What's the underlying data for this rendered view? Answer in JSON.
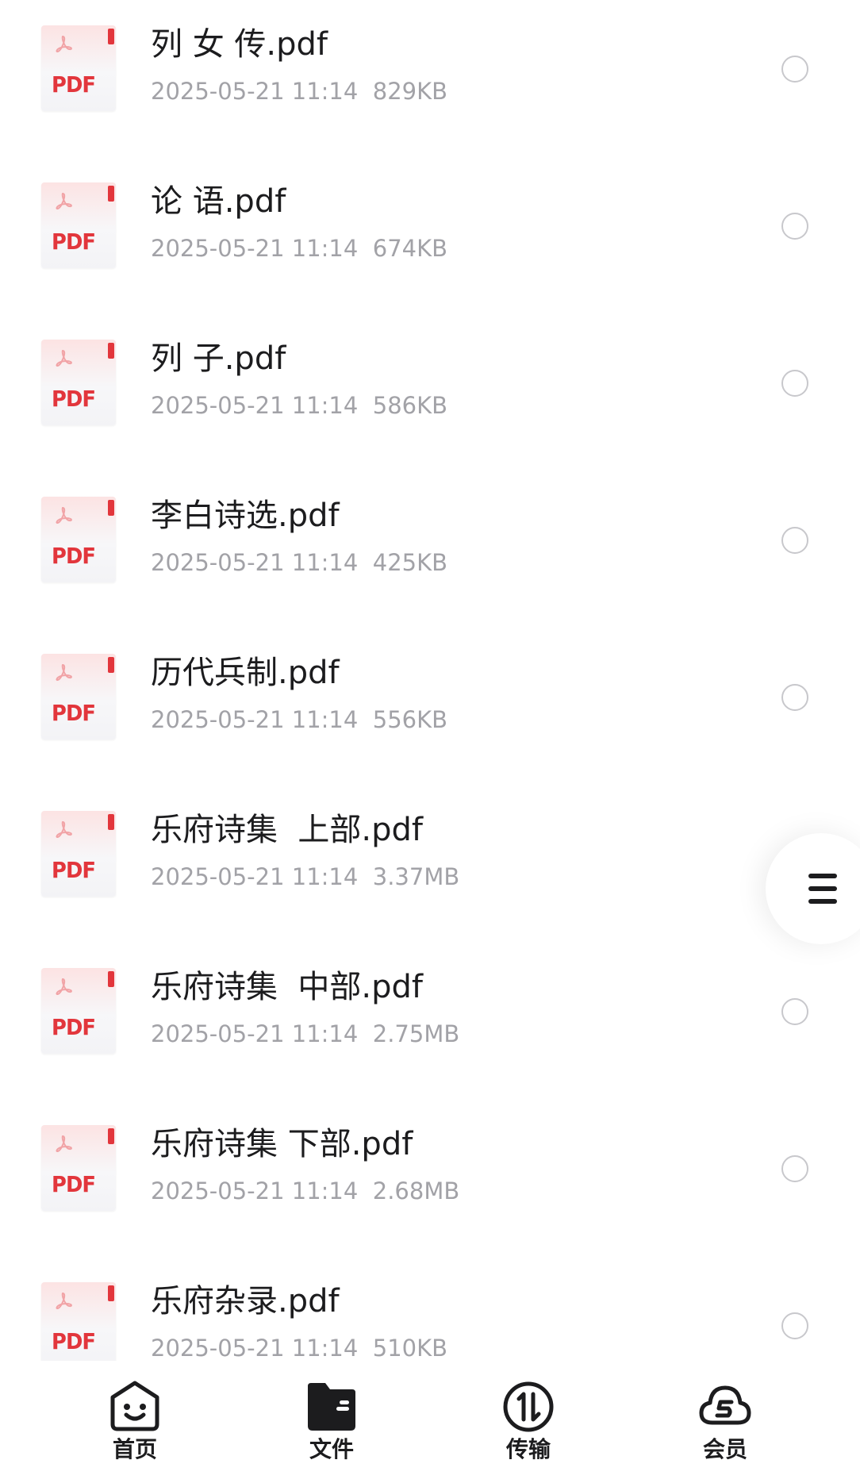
{
  "files": [
    {
      "name": "列 女 传.pdf",
      "meta": "2025-05-21 11:14  829KB",
      "type_label": "PDF"
    },
    {
      "name": "论 语.pdf",
      "meta": "2025-05-21 11:14  674KB",
      "type_label": "PDF"
    },
    {
      "name": "列 子.pdf",
      "meta": "2025-05-21 11:14  586KB",
      "type_label": "PDF"
    },
    {
      "name": "李白诗选.pdf",
      "meta": "2025-05-21 11:14  425KB",
      "type_label": "PDF"
    },
    {
      "name": "历代兵制.pdf",
      "meta": "2025-05-21 11:14  556KB",
      "type_label": "PDF"
    },
    {
      "name": "乐府诗集  上部.pdf",
      "meta": "2025-05-21 11:14  3.37MB",
      "type_label": "PDF"
    },
    {
      "name": "乐府诗集  中部.pdf",
      "meta": "2025-05-21 11:14  2.75MB",
      "type_label": "PDF"
    },
    {
      "name": "乐府诗集 下部.pdf",
      "meta": "2025-05-21 11:14  2.68MB",
      "type_label": "PDF"
    },
    {
      "name": "乐府杂录.pdf",
      "meta": "2025-05-21 11:14  510KB",
      "type_label": "PDF"
    }
  ],
  "bottom_nav": {
    "items": [
      {
        "label": "首页",
        "icon": "home-face-icon"
      },
      {
        "label": "文件",
        "icon": "folder-icon",
        "selected": true
      },
      {
        "label": "传输",
        "icon": "transfer-icon"
      },
      {
        "label": "会员",
        "icon": "vip-cloud-icon"
      }
    ]
  },
  "side_menu": {
    "icon": "menu-icon"
  },
  "colors": {
    "accent_red": "#e2363c",
    "text_primary": "#1c1c1e",
    "text_secondary": "#a2a2a7",
    "radio_border": "#c8c8cc"
  }
}
